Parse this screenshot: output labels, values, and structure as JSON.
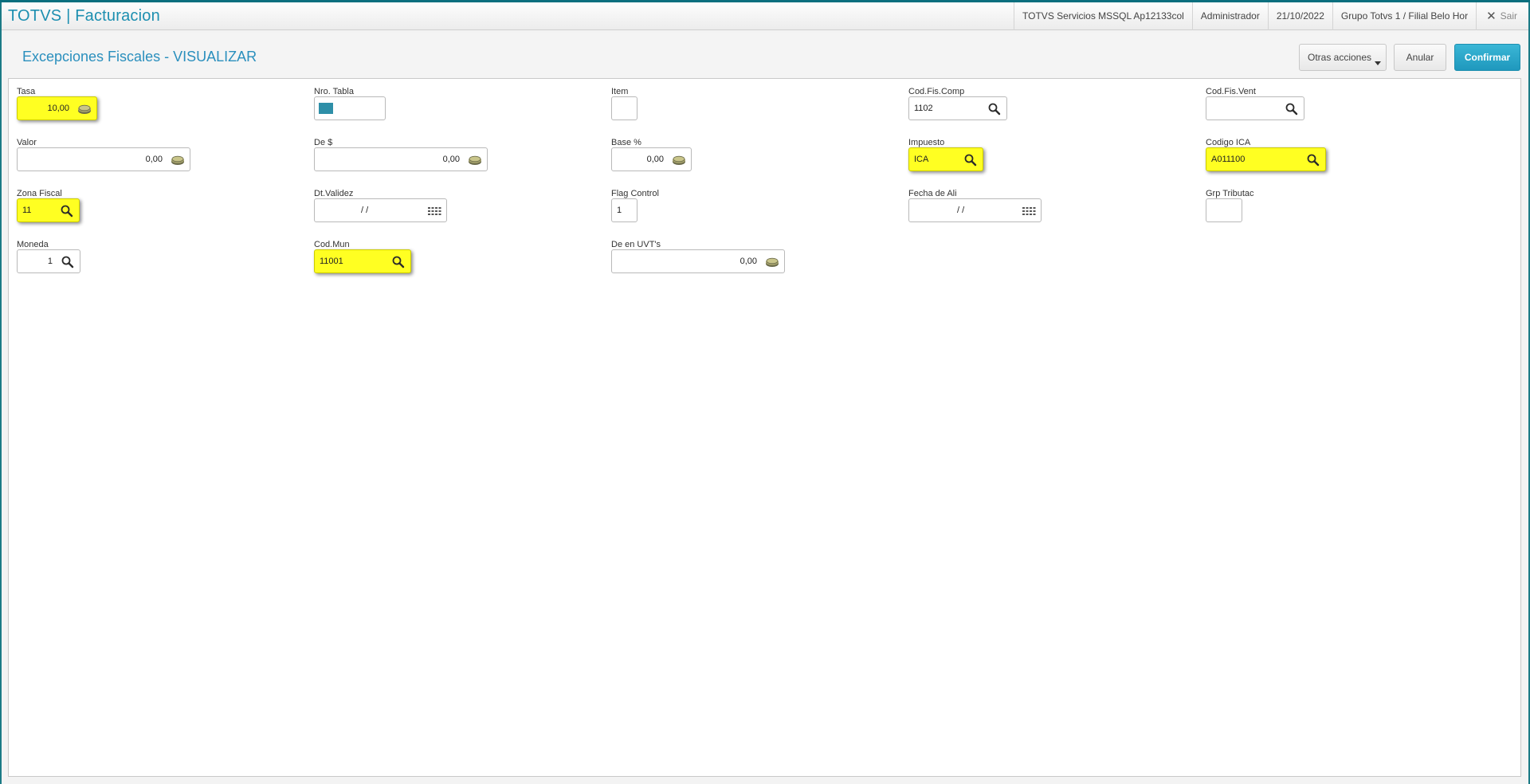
{
  "app": {
    "title": "TOTVS | Facturacion"
  },
  "topbar": {
    "environment": "TOTVS Servicios MSSQL Ap12133col",
    "user": "Administrador",
    "date": "21/10/2022",
    "company": "Grupo Totvs 1 / Filial Belo Hor",
    "exit_label": "Sair"
  },
  "header": {
    "title": "Excepciones Fiscales - VISUALIZAR",
    "more_actions_label": "Otras acciones",
    "cancel_label": "Anular",
    "confirm_label": "Confirmar"
  },
  "fields": {
    "tasa": {
      "label": "Tasa",
      "value": "10,00",
      "icon": "money-icon",
      "highlighted": true
    },
    "nro_tabla": {
      "label": "Nro. Tabla",
      "value": "",
      "color_swatch": "#2e8fa8"
    },
    "item": {
      "label": "Item",
      "value": ""
    },
    "cod_fis_comp": {
      "label": "Cod.Fis.Comp",
      "value": "1102",
      "icon": "search-icon"
    },
    "cod_fis_vent": {
      "label": "Cod.Fis.Vent",
      "value": "",
      "icon": "search-icon"
    },
    "valor": {
      "label": "Valor",
      "value": "0,00",
      "icon": "money-icon"
    },
    "de_dolar": {
      "label": "De $",
      "value": "0,00",
      "icon": "money-icon"
    },
    "base_pct": {
      "label": "Base %",
      "value": "0,00",
      "icon": "money-icon"
    },
    "impuesto": {
      "label": "Impuesto",
      "value": "ICA",
      "icon": "search-icon",
      "highlighted": true
    },
    "codigo_ica": {
      "label": "Codigo ICA",
      "value": "A011100",
      "icon": "search-icon",
      "highlighted": true
    },
    "zona_fiscal": {
      "label": "Zona Fiscal",
      "value": "11",
      "icon": "search-icon",
      "highlighted": true
    },
    "dt_validez": {
      "label": "Dt.Validez",
      "value": "/ /",
      "icon": "calendar-icon"
    },
    "flag_control": {
      "label": "Flag Control",
      "value": "1"
    },
    "fecha_de_ali": {
      "label": "Fecha de Ali",
      "value": "/ /",
      "icon": "calendar-icon"
    },
    "grp_tributac": {
      "label": "Grp Tributac",
      "value": ""
    },
    "moneda": {
      "label": "Moneda",
      "value": "1",
      "icon": "search-icon"
    },
    "cod_mun": {
      "label": "Cod.Mun",
      "value": "11001",
      "icon": "search-icon",
      "highlighted": true
    },
    "de_en_uvts": {
      "label": "De en UVT's",
      "value": "0,00",
      "icon": "money-icon"
    }
  },
  "colors": {
    "accent": "#1d8fb0",
    "highlight": "#ffff22",
    "confirm": "#2aa7cb"
  }
}
